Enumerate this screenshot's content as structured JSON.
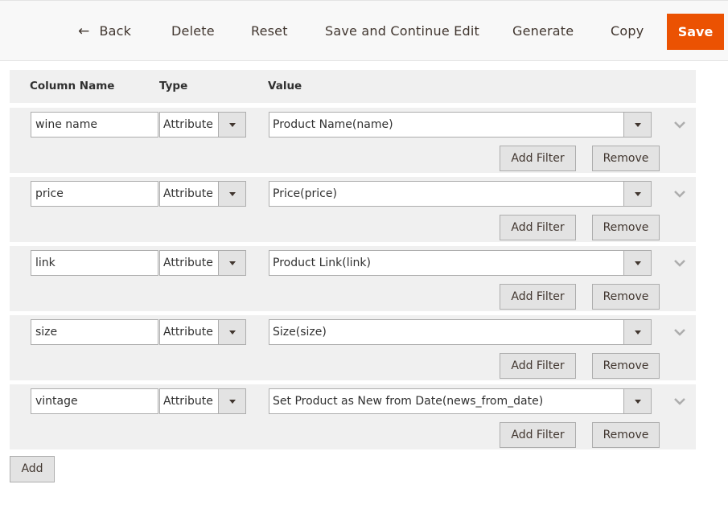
{
  "toolbar": {
    "back_label": "Back",
    "delete_label": "Delete",
    "reset_label": "Reset",
    "save_continue_label": "Save and Continue Edit",
    "generate_label": "Generate",
    "copy_label": "Copy",
    "save_label": "Save",
    "save_color": "#eb5202"
  },
  "table": {
    "headers": {
      "column_name": "Column Name",
      "type": "Type",
      "value": "Value"
    },
    "rows": [
      {
        "column_name": "wine name",
        "type": "Attribute",
        "value": "Product Name(name)"
      },
      {
        "column_name": "price",
        "type": "Attribute",
        "value": "Price(price)"
      },
      {
        "column_name": "link",
        "type": "Attribute",
        "value": "Product Link(link)"
      },
      {
        "column_name": "size",
        "type": "Attribute",
        "value": "Size(size)"
      },
      {
        "column_name": "vintage",
        "type": "Attribute",
        "value": "Set Product as New from Date(news_from_date)"
      }
    ],
    "add_filter_label": "Add Filter",
    "remove_label": "Remove"
  },
  "add_label": "Add"
}
